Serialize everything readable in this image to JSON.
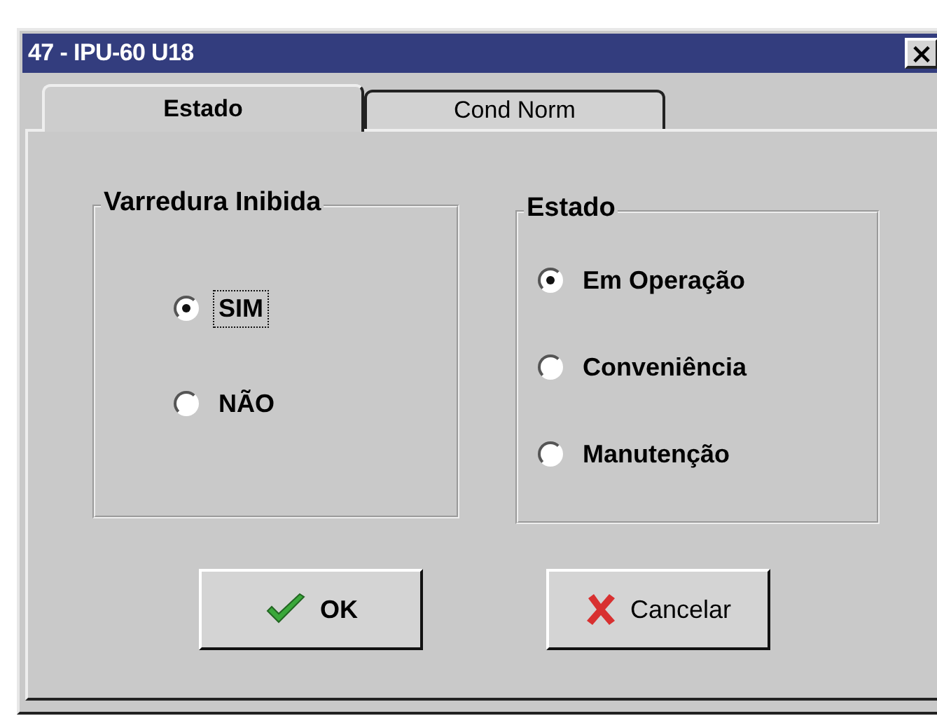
{
  "window": {
    "title": "47 - IPU-60 U18",
    "close": "×"
  },
  "tabs": [
    {
      "label": "Estado",
      "selected": true
    },
    {
      "label": "Cond Norm",
      "selected": false
    }
  ],
  "groups": [
    {
      "title": "Varredura Inibida",
      "options": [
        {
          "label": "SIM",
          "selected": true,
          "focused": true
        },
        {
          "label": "NÃO",
          "selected": false,
          "focused": false
        }
      ]
    },
    {
      "title": "Estado",
      "options": [
        {
          "label": "Em Operação",
          "selected": true,
          "focused": false
        },
        {
          "label": "Conveniência",
          "selected": false,
          "focused": false
        },
        {
          "label": "Manutenção",
          "selected": false,
          "focused": false
        }
      ]
    }
  ],
  "buttons": [
    {
      "kind": "ok",
      "label": "OK"
    },
    {
      "kind": "cancel",
      "label": "Cancelar"
    }
  ]
}
